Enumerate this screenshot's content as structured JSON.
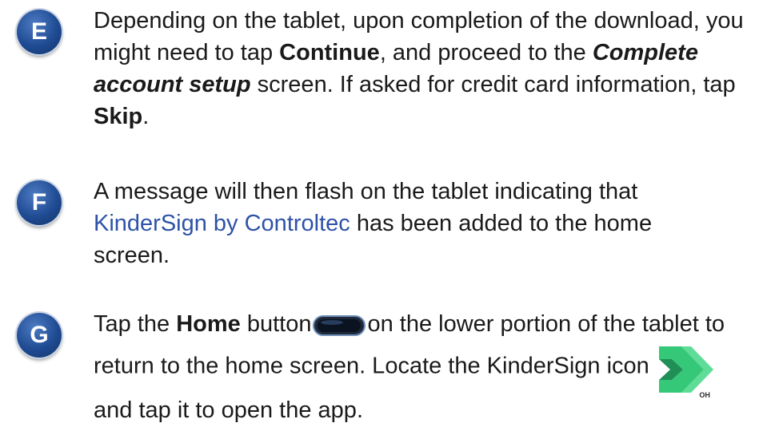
{
  "steps": [
    {
      "badge": "E",
      "t1": "Depending on the tablet, upon completion of the download, you might need to tap ",
      "b1": "Continue",
      "t2": ", and proceed to the ",
      "bi1": "Complete account setup",
      "t3": " screen.  If asked for credit card information, tap ",
      "b2": "Skip",
      "t4": "."
    },
    {
      "badge": "F",
      "t1": "A message will then flash on the tablet indicating that ",
      "link": "KinderSign by Controltec",
      "t2": " has been added to the home screen."
    },
    {
      "badge": "G",
      "t1": "Tap the ",
      "b1": "Home",
      "t2": " button",
      "t3": "on the lower portion of the tablet to return to the home screen.  Locate the KinderSign icon",
      "icon_caption": "OH",
      "t4": "and tap it to open the app."
    }
  ],
  "icons": {
    "home_button": "home-button-icon",
    "app_icon": "kindersign-app-icon"
  },
  "colors": {
    "badge": "#1f4b93",
    "link": "#2e52a8",
    "app_icon_green": "#35c878",
    "app_icon_dark": "#1f8f55"
  }
}
